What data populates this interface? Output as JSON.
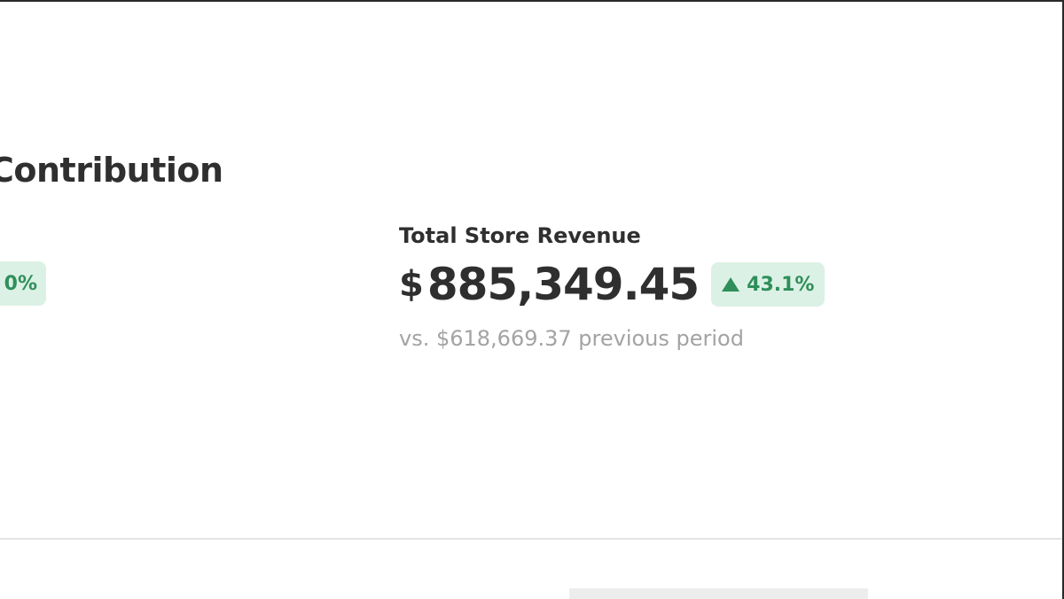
{
  "section": {
    "title": "Contribution"
  },
  "left_metric": {
    "change_fragment": "0%"
  },
  "metric": {
    "label": "Total Store Revenue",
    "currency_symbol": "$",
    "value": "885,349.45",
    "change": "43.1%",
    "comparison": "vs. $618,669.37 previous period",
    "change_color": "#2f8f5b",
    "change_bg": "#dcf1e5",
    "icon": "up-arrow-icon"
  }
}
